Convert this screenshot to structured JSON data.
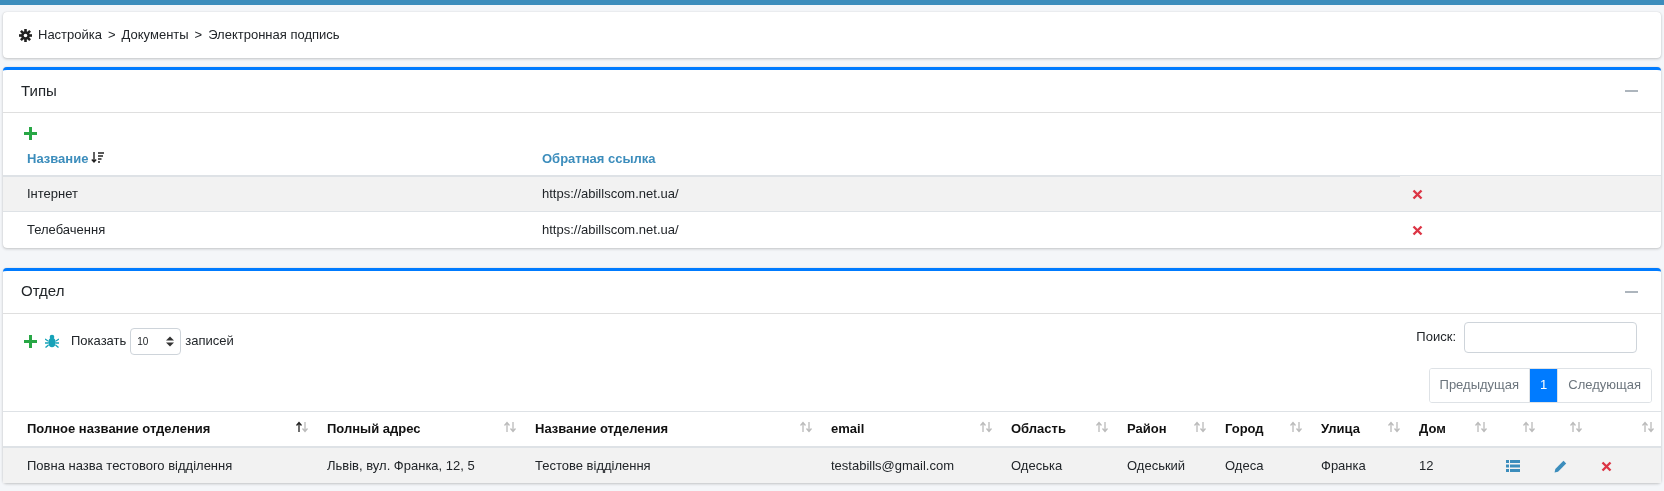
{
  "breadcrumb": {
    "separator": ">",
    "items": [
      "Настройка",
      "Документы",
      "Электронная подпись"
    ]
  },
  "types_panel": {
    "title": "Типы",
    "table": {
      "columns": [
        {
          "label": "Название",
          "sorted_descending": true
        },
        {
          "label": "Обратная ссылка",
          "sorted_descending": false
        }
      ],
      "rows": [
        {
          "name": "Інтернет",
          "link": "https://abillscom.net.ua/"
        },
        {
          "name": "Телебачення",
          "link": "https://abillscom.net.ua/"
        }
      ]
    }
  },
  "department_panel": {
    "title": "Отдел",
    "length": {
      "label_before": "Показать",
      "value": "10",
      "label_after": "записей"
    },
    "search": {
      "label": "Поиск:"
    },
    "pagination": [
      {
        "label": "Предыдущая",
        "selected": false
      },
      {
        "label": "1",
        "selected": true
      },
      {
        "label": "Следующая",
        "selected": false
      }
    ],
    "table": {
      "columns": [
        {
          "label": "Полное название отделения",
          "sorted_ascending": true
        },
        {
          "label": "Полный адрес",
          "sorted_ascending": false
        },
        {
          "label": "Название отделения",
          "sorted_ascending": false
        },
        {
          "label": "email",
          "sorted_ascending": false
        },
        {
          "label": "Область",
          "sorted_ascending": false
        },
        {
          "label": "Район",
          "sorted_ascending": false
        },
        {
          "label": "Город",
          "sorted_ascending": false
        },
        {
          "label": "Улица",
          "sorted_ascending": false
        },
        {
          "label": "Дом",
          "sorted_ascending": false
        },
        {
          "sorted_ascending": false
        },
        {
          "sorted_ascending": false
        },
        {
          "sorted_ascending": false
        }
      ],
      "rows": [
        {
          "cells": [
            "Повна назва тестового відділення",
            "Львів, вул. Франка, 12, 5",
            "Тестове відділення",
            "testabills@gmail.com",
            "Одеська",
            "Одеський",
            "Одеса",
            "Франка",
            "12"
          ]
        }
      ]
    }
  }
}
